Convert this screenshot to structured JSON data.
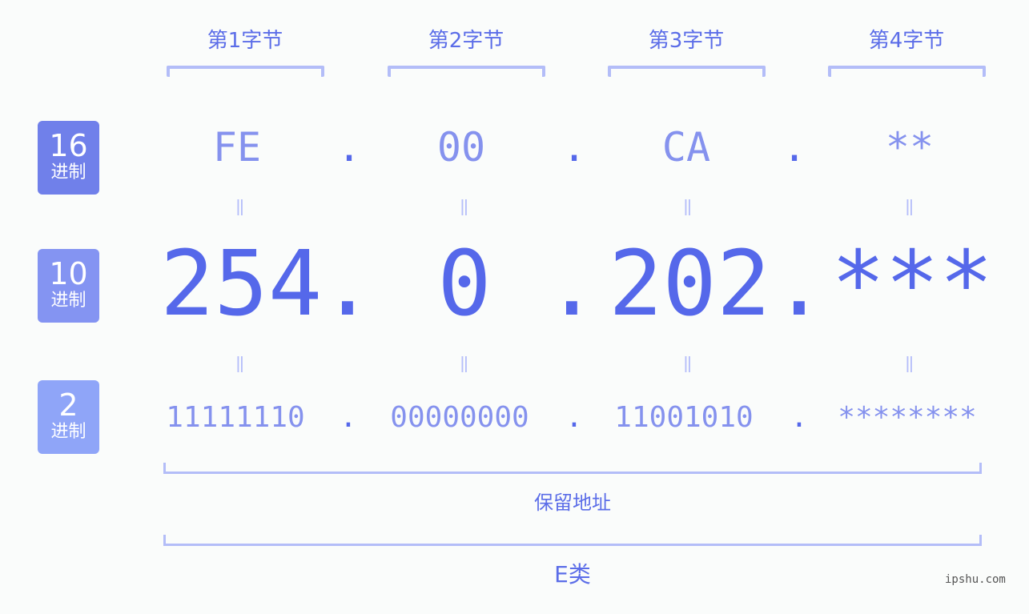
{
  "byte_labels": [
    "第1字节",
    "第2字节",
    "第3字节",
    "第4字节"
  ],
  "rows": {
    "hex": {
      "badge_number": "16",
      "badge_unit": "进制",
      "badge_color": "#7080ea",
      "values": [
        "FE",
        "00",
        "CA",
        "**"
      ]
    },
    "decimal": {
      "badge_number": "10",
      "badge_unit": "进制",
      "badge_color": "#8494f2",
      "values": [
        "254",
        "0",
        "202",
        "***"
      ]
    },
    "binary": {
      "badge_number": "2",
      "badge_unit": "进制",
      "badge_color": "#8fa5f8",
      "values": [
        "11111110",
        "00000000",
        "11001010",
        "********"
      ]
    }
  },
  "separator": ".",
  "equals_symbol": "=",
  "address_type": "保留地址",
  "address_class": "E类",
  "watermark": "ipshu.com",
  "colors": {
    "primary": "#5568ea",
    "secondary": "#8592ee",
    "bracket": "#b3bdf8",
    "background": "#fafcfb"
  }
}
